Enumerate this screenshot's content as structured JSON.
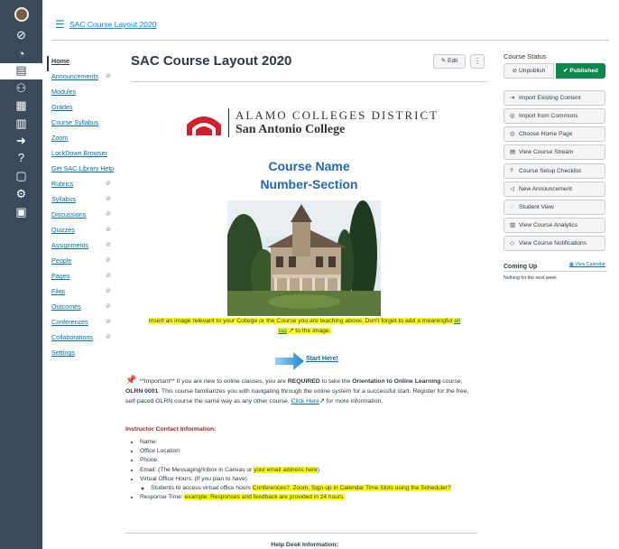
{
  "breadcrumb": {
    "course": "SAC Course Layout 2020"
  },
  "course_nav": [
    {
      "label": "Home",
      "hidden": false,
      "active": true
    },
    {
      "label": "Announcements",
      "hidden": true
    },
    {
      "label": "Modules",
      "hidden": false
    },
    {
      "label": "Grades",
      "hidden": false
    },
    {
      "label": "Course Syllabus",
      "hidden": false
    },
    {
      "label": "Zoom",
      "hidden": false
    },
    {
      "label": "LockDown Browser",
      "hidden": false
    },
    {
      "label": "Get SAC Library Help",
      "hidden": false
    },
    {
      "label": "Rubrics",
      "hidden": true
    },
    {
      "label": "Syllabus",
      "hidden": true
    },
    {
      "label": "Discussions",
      "hidden": true
    },
    {
      "label": "Quizzes",
      "hidden": true
    },
    {
      "label": "Assignments",
      "hidden": true
    },
    {
      "label": "People",
      "hidden": true
    },
    {
      "label": "Pages",
      "hidden": true
    },
    {
      "label": "Files",
      "hidden": true
    },
    {
      "label": "Outcomes",
      "hidden": true
    },
    {
      "label": "Conferences",
      "hidden": true
    },
    {
      "label": "Collaborations",
      "hidden": true
    },
    {
      "label": "Settings",
      "hidden": false
    }
  ],
  "page": {
    "title": "SAC Course Layout 2020",
    "edit_label": "Edit",
    "more_label": "⋮",
    "logo_line1": "ALAMO COLLEGES DISTRICT",
    "logo_line2": "San Antonio College",
    "course_name": "Course Name",
    "number_section": "Number-Section",
    "insert_text_1": "Insert an image relevant to your College or the Course you are teaching above. Don't forget to add a meaningful ",
    "insert_link_1": "alt",
    "insert_link_2": "tag",
    "insert_text_2": " to the image.",
    "start_here": "Start Here!",
    "important_1": "**Important** If you are new to online classes, you are ",
    "important_required": "REQUIRED",
    "important_2": " to take the ",
    "important_orientation": "Orientation to Online Learning",
    "important_3": " course, ",
    "important_olrn": "OLRN 0001",
    "important_4": ". This course familiarizes you with navigating through the online system for a successful start. Register for the free, self-paced OLRN course the same way as any other course. ",
    "important_link": "Click Here",
    "important_5": " for more information.",
    "contact_heading": "Instructor Contact Information:",
    "contact_name": "Name:",
    "contact_office": "Office Location:",
    "contact_phone": "Phone:",
    "contact_email_1": "Email: (The Messaging/Inbox in Canvas or ",
    "contact_email_hl": "your email address here",
    "contact_email_2": ")",
    "contact_virtual": "Virtual Office Hours: (If you plan to have)",
    "contact_virtual_sub_1": "Students to access virtual office hours ",
    "contact_virtual_sub_hl": "Conferences?, Zoom, Sign-up in Calendar Time Slots using the Scheduler?",
    "contact_response_1": "Response Time: ",
    "contact_response_hl": "example: Responses and feedback are provided in 24 hours.",
    "help_heading": "Help Desk Information:"
  },
  "sidebar": {
    "course_status": "Course Status",
    "unpublish": "Unpublish",
    "published": "Published",
    "buttons": [
      {
        "label": "Import Existing Content",
        "icon": "import-icon"
      },
      {
        "label": "Import from Commons",
        "icon": "commons-icon"
      },
      {
        "label": "Choose Home Page",
        "icon": "home-page-icon"
      },
      {
        "label": "View Course Stream",
        "icon": "stream-icon"
      },
      {
        "label": "Course Setup Checklist",
        "icon": "checklist-icon"
      },
      {
        "label": "New Announcement",
        "icon": "announcement-icon"
      },
      {
        "label": "Student View",
        "icon": "student-view-icon"
      },
      {
        "label": "View Course Analytics",
        "icon": "analytics-icon"
      },
      {
        "label": "View Course Notifications",
        "icon": "notifications-icon"
      }
    ],
    "coming_up": "Coming Up",
    "view_calendar": "View Calendar",
    "nothing": "Nothing for the next week"
  },
  "global_nav": [
    "account-avatar",
    "admin-icon",
    "dashboard-icon",
    "courses-icon",
    "groups-icon",
    "calendar-icon",
    "inbox-icon",
    "commons-icon",
    "help-icon",
    "history-icon",
    "settings-icon",
    "studio-icon"
  ],
  "colors": {
    "nav_bg": "#394b58",
    "link": "#0770a3",
    "published": "#0b874b",
    "highlight": "#ffff00",
    "course_name": "#2468b2"
  }
}
